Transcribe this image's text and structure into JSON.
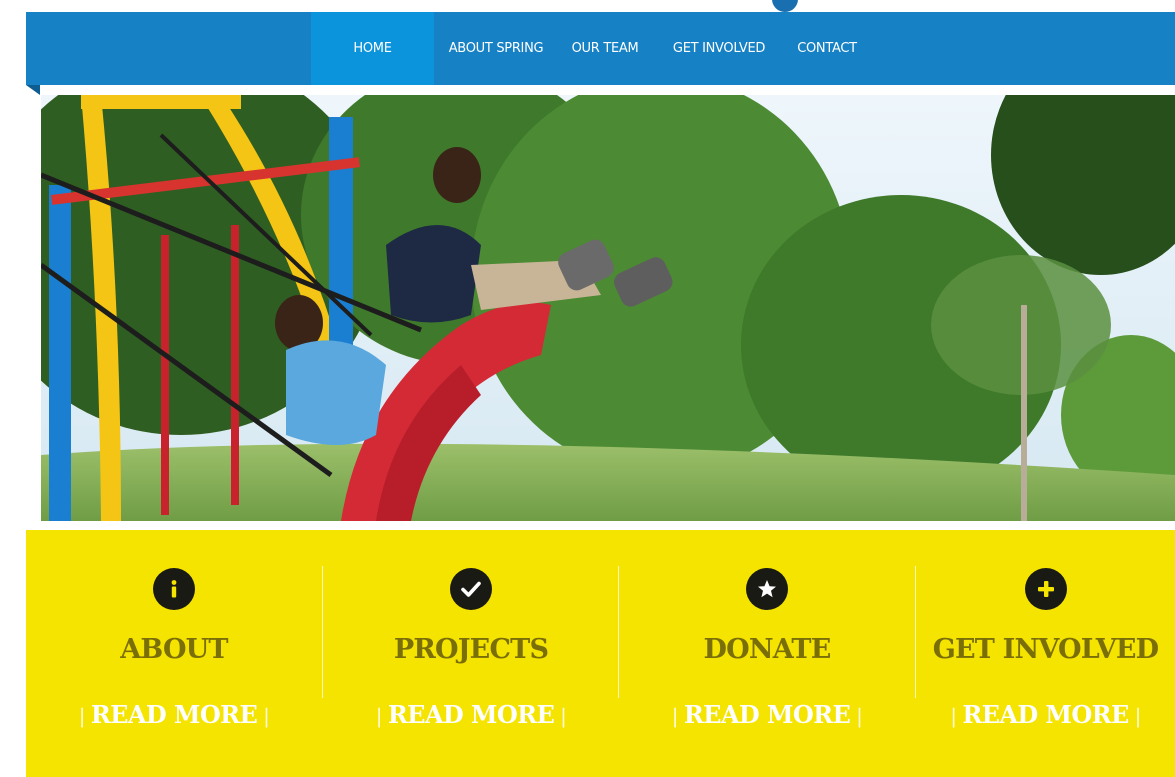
{
  "nav": {
    "items": [
      {
        "label": "HOME",
        "active": true
      },
      {
        "label": "ABOUT SPRING",
        "active": false
      },
      {
        "label": "OUR TEAM",
        "active": false
      },
      {
        "label": "GET INVOLVED",
        "active": false
      },
      {
        "label": "CONTACT",
        "active": false
      }
    ]
  },
  "hero": {
    "image": "two-children-on-playground-swing-photo"
  },
  "features": [
    {
      "icon": "info-icon",
      "title": "ABOUT",
      "link": "READ MORE"
    },
    {
      "icon": "check-icon",
      "title": "PROJECTS",
      "link": "READ MORE"
    },
    {
      "icon": "star-icon",
      "title": "DONATE",
      "link": "READ MORE"
    },
    {
      "icon": "plus-icon",
      "title": "GET INVOLVED",
      "link": "READ MORE"
    }
  ],
  "colors": {
    "nav_bar": "#1681c4",
    "nav_active": "#0b93dc",
    "feature_band": "#f5e300",
    "feature_title": "#7a6e08",
    "icon_fill": "#1a1a14"
  }
}
